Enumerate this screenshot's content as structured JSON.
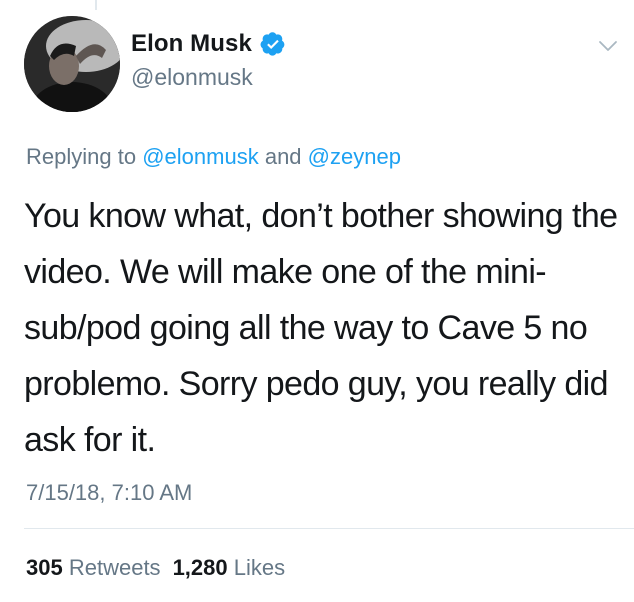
{
  "user": {
    "name": "Elon Musk",
    "handle": "@elonmusk",
    "verified": true
  },
  "reply": {
    "prefix": "Replying to",
    "mention1": "@elonmusk",
    "and": "and",
    "mention2": "@zeynep"
  },
  "tweet": {
    "text": "You know what, don’t bother showing the video. We will make one of the mini-sub/pod going all the way to Cave 5 no problemo. Sorry pedo guy, you really did ask for it.",
    "timestamp": "7/15/18, 7:10 AM"
  },
  "stats": {
    "retweets_count": "305",
    "retweets_label": "Retweets",
    "likes_count": "1,280",
    "likes_label": "Likes"
  },
  "colors": {
    "verified": "#1da1f2",
    "link": "#1da1f2",
    "secondary_text": "#657786",
    "primary_text": "#14171a"
  },
  "icons": {
    "verified": "verified-badge-icon",
    "menu": "chevron-down-icon"
  }
}
